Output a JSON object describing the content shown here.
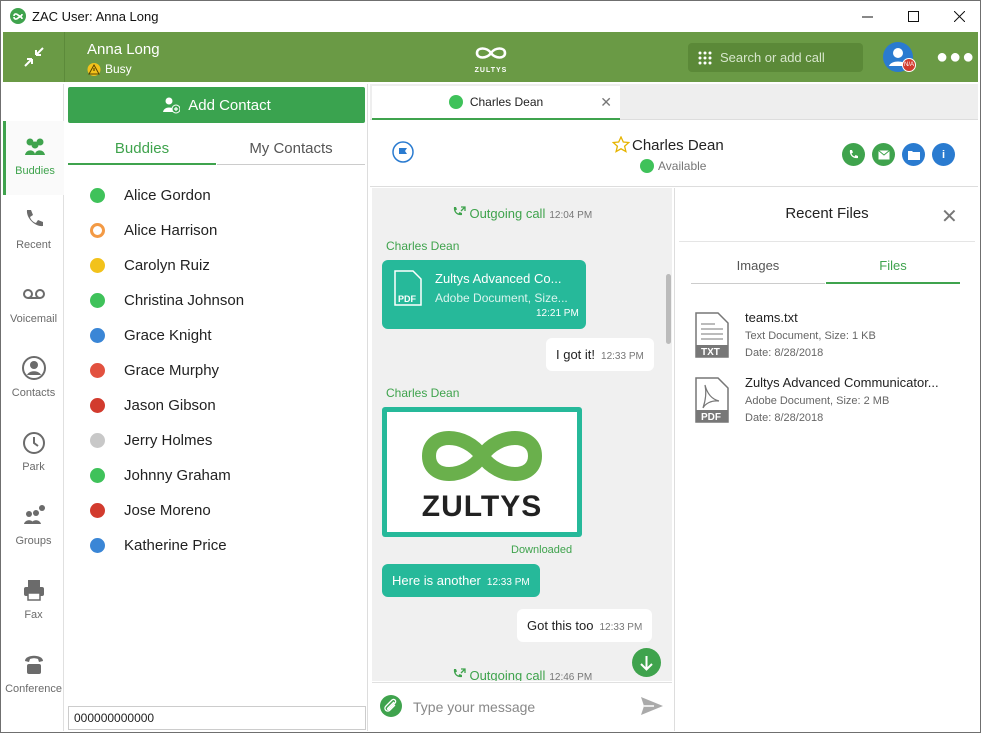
{
  "window": {
    "title": "ZAC User: Anna Long"
  },
  "header": {
    "user_name": "Anna Long",
    "status": "Busy",
    "logo_text": "ZULTYS",
    "search_placeholder": "Search or add call",
    "presence_badge": "N/A"
  },
  "nav": {
    "items": [
      {
        "label": "Buddies",
        "icon": "buddies-icon"
      },
      {
        "label": "Recent",
        "icon": "phone-icon"
      },
      {
        "label": "Voicemail",
        "icon": "voicemail-icon"
      },
      {
        "label": "Contacts",
        "icon": "contact-icon"
      },
      {
        "label": "Park",
        "icon": "park-icon"
      },
      {
        "label": "Groups",
        "icon": "groups-icon"
      },
      {
        "label": "Fax",
        "icon": "fax-icon"
      },
      {
        "label": "Conference",
        "icon": "conference-icon"
      }
    ]
  },
  "contacts": {
    "add_label": "Add Contact",
    "tabs": [
      "Buddies",
      "My Contacts"
    ],
    "buddies": [
      {
        "name": "Alice Gordon",
        "status": "available"
      },
      {
        "name": "Alice Harrison",
        "status": "away"
      },
      {
        "name": "Carolyn Ruiz",
        "status": "busy"
      },
      {
        "name": "Christina Johnson",
        "status": "available"
      },
      {
        "name": "Grace Knight",
        "status": "info"
      },
      {
        "name": "Grace Murphy",
        "status": "dnd"
      },
      {
        "name": "Jason Gibson",
        "status": "na"
      },
      {
        "name": "Jerry Holmes",
        "status": "offline"
      },
      {
        "name": "Johnny Graham",
        "status": "available"
      },
      {
        "name": "Jose Moreno",
        "status": "na"
      },
      {
        "name": "Katherine Price",
        "status": "info"
      }
    ],
    "dialer_value": "000000000000"
  },
  "chat": {
    "tab_name": "Charles Dean",
    "contact_name": "Charles Dean",
    "contact_status": "Available",
    "messages": {
      "call1_label": "Outgoing call",
      "call1_time": "12:04 PM",
      "sender1": "Charles Dean",
      "file_title": "Zultys Advanced Co...",
      "file_meta": "Adobe Document, Size...",
      "file_time": "12:21 PM",
      "reply1": "I got it!",
      "reply1_time": "12:33 PM",
      "sender2": "Charles Dean",
      "image_logo_text": "ZULTYS",
      "downloaded": "Downloaded",
      "msg_in2": "Here is another",
      "msg_in2_time": "12:33 PM",
      "reply2": "Got this too",
      "reply2_time": "12:33 PM",
      "call2_label": "Outgoing call",
      "call2_time": "12:46 PM"
    },
    "composer_placeholder": "Type your message"
  },
  "recent_files": {
    "title": "Recent Files",
    "tabs": [
      "Images",
      "Files"
    ],
    "files": [
      {
        "name": "teams.txt",
        "meta": "Text Document, Size: 1 KB",
        "date": "Date: 8/28/2018",
        "type": "TXT"
      },
      {
        "name": "Zultys Advanced Communicator...",
        "meta": "Adobe Document, Size: 2 MB",
        "date": "Date: 8/28/2018",
        "type": "PDF"
      }
    ]
  },
  "colors": {
    "brand_green": "#6a9a45",
    "accent_green": "#3fa34d",
    "teal_bubble": "#26b99a"
  }
}
